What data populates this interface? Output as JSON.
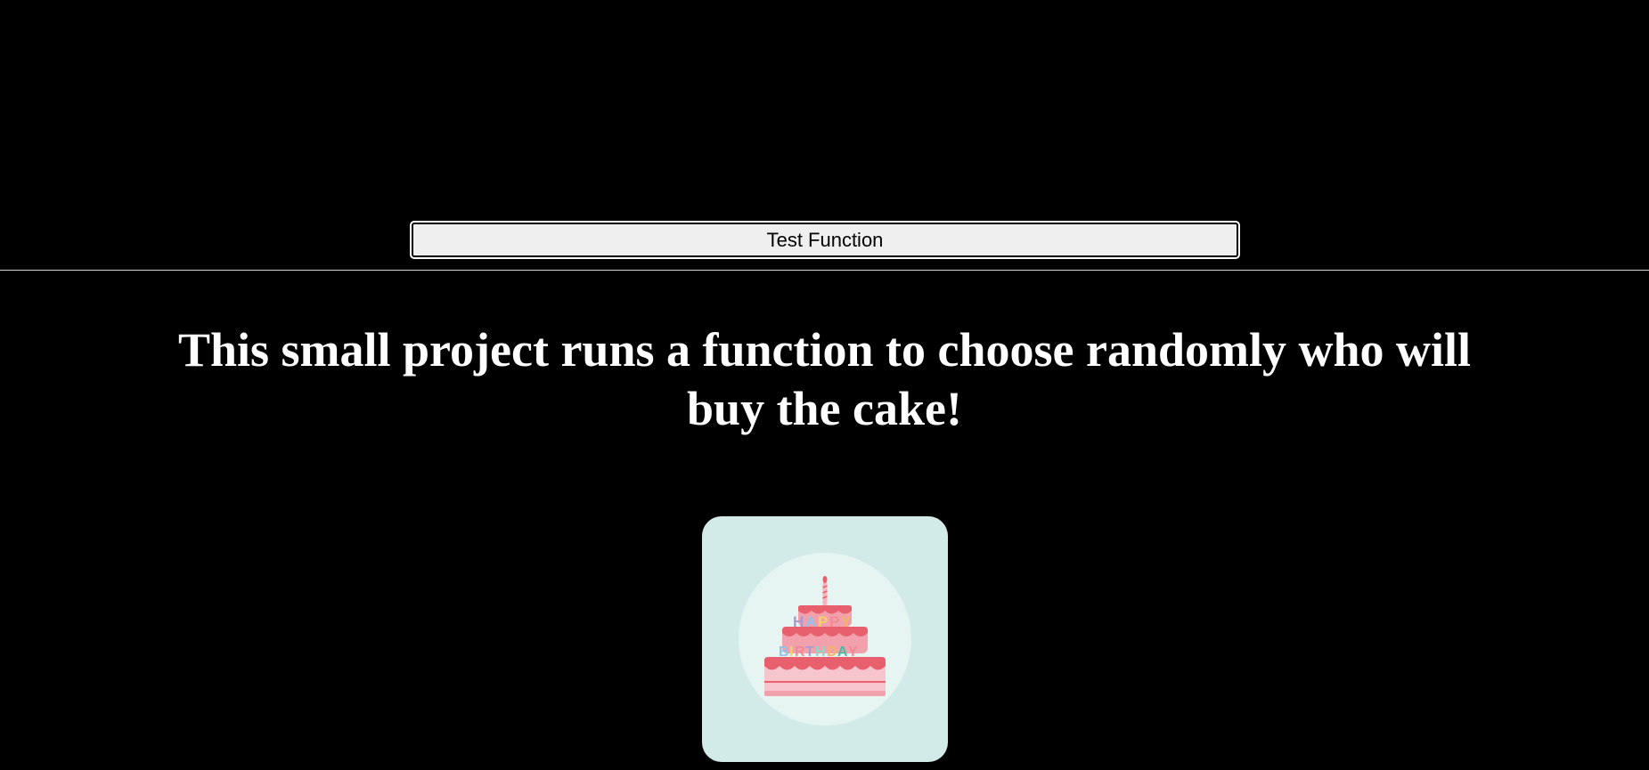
{
  "toolbar": {
    "test_button_label": "Test Function"
  },
  "main": {
    "heading": "This small project runs a function to choose randomly who will buy the cake!"
  },
  "cake_image": {
    "icon": "birthday-cake-icon",
    "alt": "HAPPY BIRTHDAY",
    "colors": {
      "card_background": "#d2ebe9",
      "circle": "#e6f4f2",
      "cake_pink": "#f2a0ab",
      "cake_red": "#e8606e",
      "cake_light": "#f7c6cd"
    }
  }
}
